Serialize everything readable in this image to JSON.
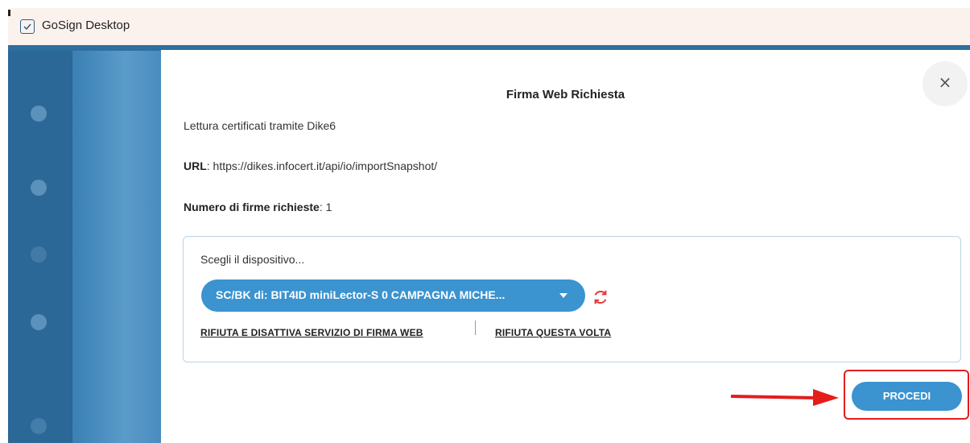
{
  "window": {
    "title": "GoSign Desktop",
    "icon": "checkbox-icon"
  },
  "dialog": {
    "title": "Firma Web Richiesta",
    "close_label": "×",
    "description": "Lettura certificati tramite Dike6",
    "url_label": "URL",
    "url_value": ": https://dikes.infocert.it/api/io/importSnapshot/",
    "signatures_label": "Numero di firme richieste",
    "signatures_value": ": 1",
    "device": {
      "prompt": "Scegli il dispositivo...",
      "selected": "SC/BK di: BIT4ID miniLector-S 0 CAMPAGNA MICHE...",
      "refresh_icon": "refresh-icon"
    },
    "links": {
      "disable": "RIFIUTA E DISATTIVA SERVIZIO DI FIRMA WEB",
      "refuse_once": "RIFIUTA QUESTA VOLTA"
    },
    "proceed_label": "PROCEDI"
  },
  "colors": {
    "accent": "#3b93cf",
    "annotation": "#e41c1c",
    "background": "#3d80b3"
  }
}
